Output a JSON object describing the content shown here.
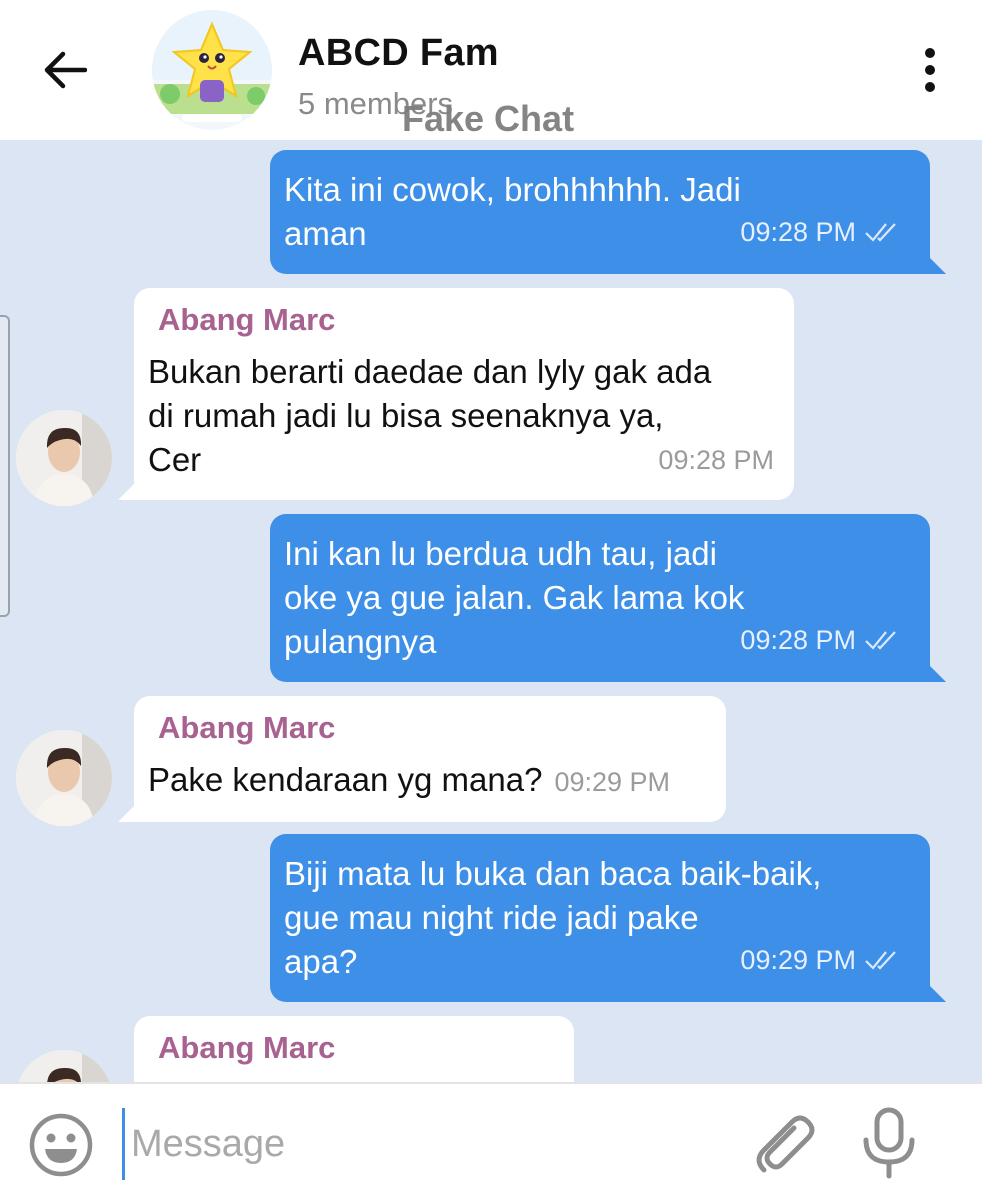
{
  "header": {
    "title": "ABCD Fam",
    "subtitle": "5 members",
    "watermark": "Fake Chat"
  },
  "messages": [
    {
      "direction": "out",
      "text_lines": [
        "Kita ini cowok, brohhhhhh. Jadi",
        "aman"
      ],
      "time": "09:28 PM",
      "status": "read"
    },
    {
      "direction": "in",
      "sender": "Abang Marc",
      "text_lines": [
        "Bukan berarti daedae dan lyly gak ada",
        "di rumah jadi lu bisa seenaknya ya,",
        "Cer"
      ],
      "time": "09:28 PM"
    },
    {
      "direction": "out",
      "text_lines": [
        "Ini kan lu berdua udh tau, jadi",
        "oke ya gue jalan. Gak lama kok",
        "pulangnya"
      ],
      "time": "09:28 PM",
      "status": "read"
    },
    {
      "direction": "in",
      "sender": "Abang Marc",
      "text_lines": [
        "Pake kendaraan yg mana?"
      ],
      "time": "09:29 PM"
    },
    {
      "direction": "out",
      "text_lines": [
        "Biji mata lu buka dan baca baik-baik,",
        "gue mau night ride jadi pake",
        "apa?"
      ],
      "time": "09:29 PM",
      "status": "read"
    },
    {
      "direction": "in",
      "sender": "Abang Marc",
      "text_lines": []
    }
  ],
  "input": {
    "placeholder": "Message"
  },
  "colors": {
    "chat_background": "#dbe5f3",
    "outgoing_bubble": "#3d8fe8",
    "incoming_bubble": "#ffffff",
    "sender_name": "#a7628f"
  },
  "icons": [
    "back-arrow-icon",
    "more-vertical-icon",
    "read-checkmarks-icon",
    "emoji-icon",
    "paperclip-icon",
    "microphone-icon"
  ]
}
